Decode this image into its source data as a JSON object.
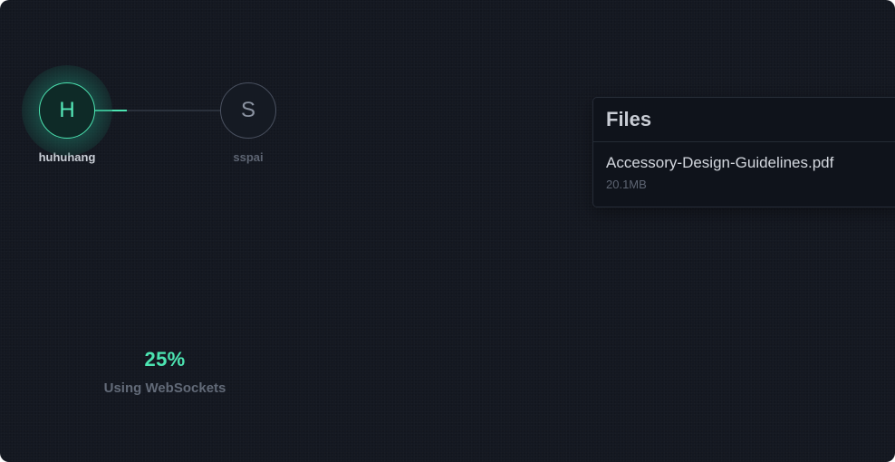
{
  "peers": {
    "self": {
      "initial": "H",
      "name": "huhuhang"
    },
    "remote": {
      "initial": "S",
      "name": "sspai"
    }
  },
  "transfer": {
    "progress_percent": 25,
    "progress_label": "25%",
    "method_label": "Using WebSockets"
  },
  "files_panel": {
    "title": "Files",
    "files": [
      {
        "name": "Accessory-Design-Guidelines.pdf",
        "size": "20.1MB"
      }
    ]
  },
  "colors": {
    "background": "#141821",
    "accent": "#4ce4b1",
    "panel": "#0f131b",
    "muted_text": "#5d6472"
  },
  "icons": {
    "connection": "connection-line-icon"
  }
}
